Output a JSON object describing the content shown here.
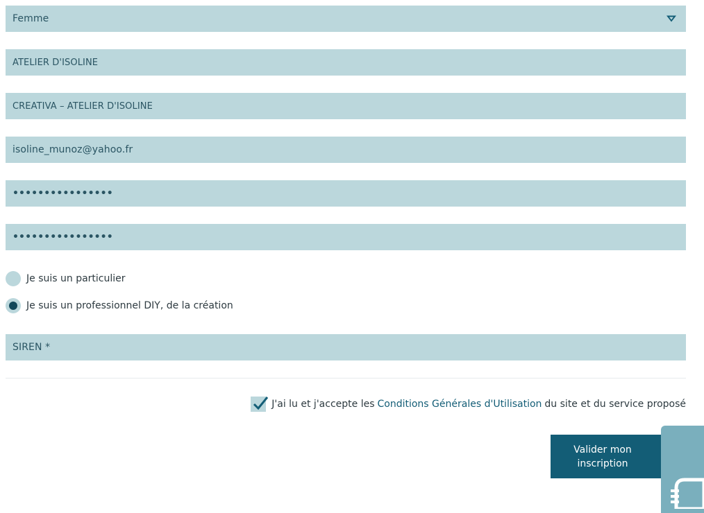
{
  "form": {
    "civility": {
      "value": "Femme"
    },
    "company_name": {
      "value": "ATELIER D'ISOLINE"
    },
    "trade_name": {
      "value": "CREATIVA – ATELIER D'ISOLINE"
    },
    "email": {
      "value": "isoline_munoz@yahoo.fr"
    },
    "password": {
      "value": "••••••••••••••••"
    },
    "password_confirm": {
      "value": "••••••••••••••••"
    },
    "account_type": {
      "options": [
        {
          "label": "Je suis un particulier",
          "selected": false
        },
        {
          "label": "Je suis un professionnel DIY, de la création",
          "selected": true
        }
      ]
    },
    "siren": {
      "placeholder": "SIREN *"
    },
    "terms": {
      "checked": true,
      "text_before": "J'ai lu et j'accepte les",
      "link": "Conditions Générales d'Utilisation",
      "text_after": "du site et du service proposé"
    },
    "submit_label": "Valider mon inscription"
  },
  "colors": {
    "field_bg": "#bbd7dc",
    "accent": "#135d76",
    "radio_selected": "#12475a",
    "widget_bg": "#7aafbd"
  },
  "icons": {
    "select": "chevron-down-icon",
    "check": "checkmark-icon",
    "widget": "chat-icon"
  }
}
